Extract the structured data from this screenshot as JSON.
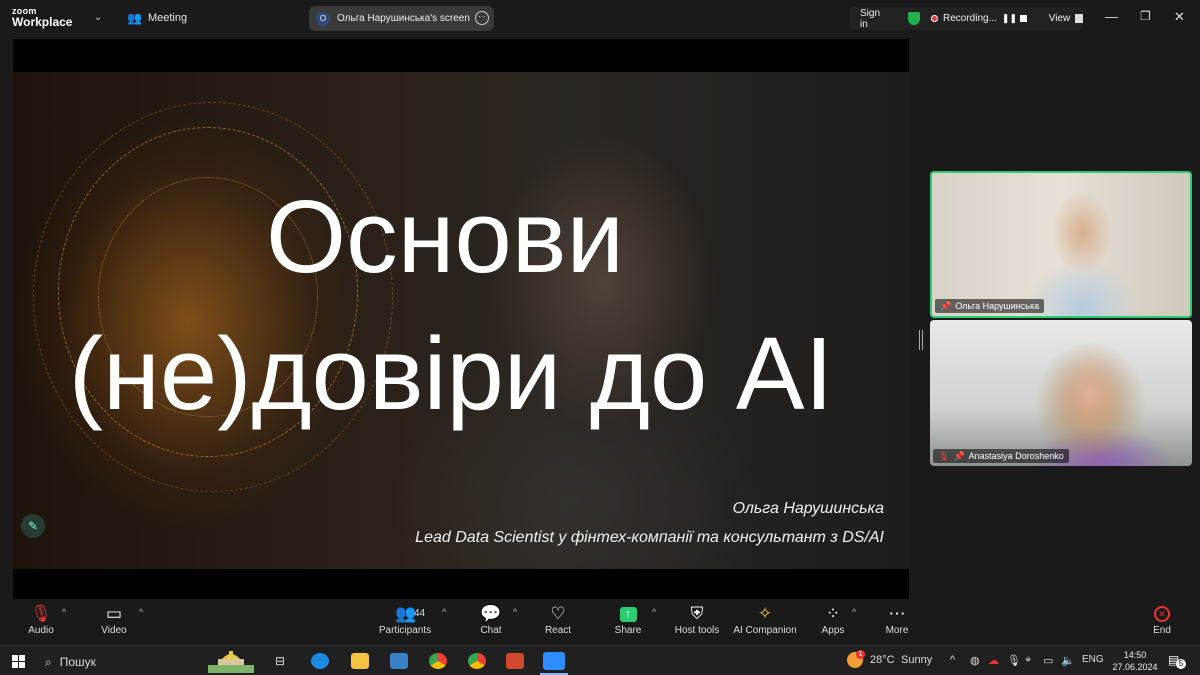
{
  "app": {
    "logo_line1": "zoom",
    "logo_line2": "Workplace"
  },
  "header": {
    "meeting_label": "Meeting",
    "screen_share_label": "Ольга Нарушинська's screen",
    "screen_share_initial": "O",
    "sign_in": "Sign in",
    "recording": "Recording...",
    "view": "View"
  },
  "slide": {
    "title_line1": "Основи",
    "title_line2": "(не)довіри до AI",
    "author": "Ольга Нарушинська",
    "role": "Lead Data Scientist у фінтех-компанії та консультант з DS/AI"
  },
  "participants_video": [
    {
      "name": "Ольга Нарушинська",
      "active_speaker": true
    },
    {
      "name": "Anastasiya Doroshenko",
      "muted": true
    }
  ],
  "toolbar": {
    "audio": "Audio",
    "video": "Video",
    "participants": "Participants",
    "participants_count": "44",
    "chat": "Chat",
    "react": "React",
    "share": "Share",
    "host_tools": "Host tools",
    "ai_companion": "AI Companion",
    "apps": "Apps",
    "more": "More",
    "end": "End"
  },
  "taskbar": {
    "search_placeholder": "Пошук",
    "weather_temp": "28°C",
    "weather_text": "Sunny",
    "weather_badge": "1",
    "language": "ENG",
    "time": "14:50",
    "date": "27.06.2024",
    "notifications": "5"
  },
  "colors": {
    "accent_green": "#2ecc71",
    "end_red": "#e33333",
    "toolbar_bg": "#1a1a1a"
  }
}
